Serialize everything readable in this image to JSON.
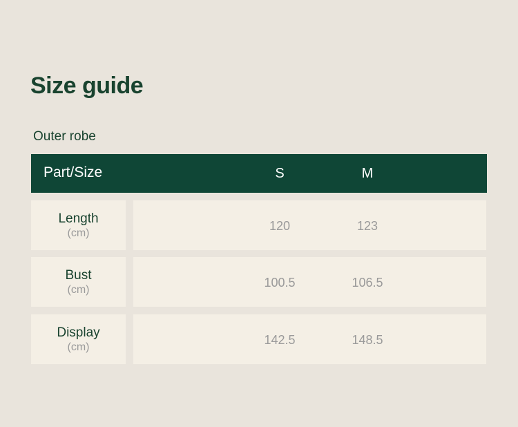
{
  "title": "Size guide",
  "subtitle": "Outer robe",
  "header": {
    "part_label": "Part/Size",
    "sizes": [
      "S",
      "M"
    ]
  },
  "rows": [
    {
      "name": "Length",
      "unit": "(cm)",
      "values": [
        "120",
        "123"
      ]
    },
    {
      "name": "Bust",
      "unit": "(cm)",
      "values": [
        "100.5",
        "106.5"
      ]
    },
    {
      "name": "Display",
      "unit": "(cm)",
      "values": [
        "142.5",
        "148.5"
      ]
    }
  ],
  "colors": {
    "background": "#e9e4dc",
    "header_bg": "#0f4636",
    "title_text": "#19432f",
    "cell_bg": "#f4efe5",
    "value_text": "#9a9a9a"
  }
}
